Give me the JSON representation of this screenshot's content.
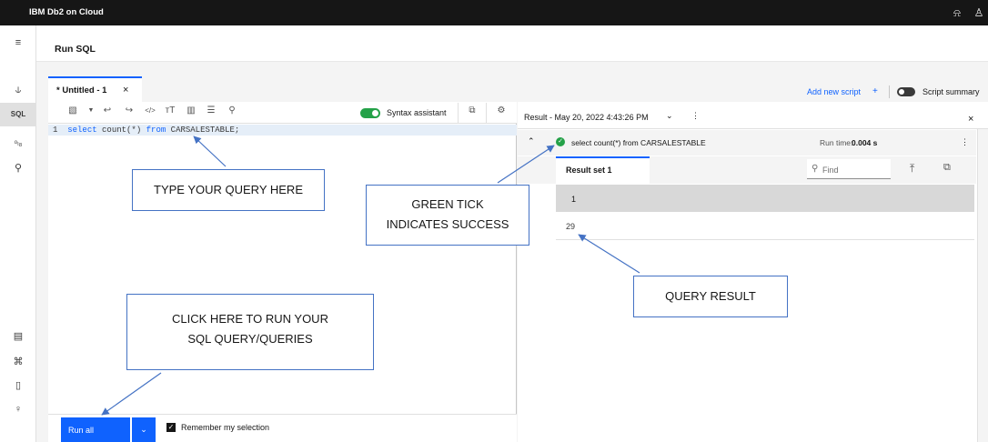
{
  "app": {
    "title": "IBM Db2 on Cloud"
  },
  "page": {
    "title": "Run SQL"
  },
  "rail": {
    "items": [
      {
        "icon": "menu-icon",
        "glyph": "≡"
      },
      {
        "icon": "chart-icon",
        "glyph": "⩘"
      },
      {
        "icon": "sql-icon",
        "glyph": "SQL"
      },
      {
        "icon": "data-icon",
        "glyph": "ⁱ⁰"
      },
      {
        "icon": "tool-icon",
        "glyph": "✎"
      },
      {
        "icon": "console-icon",
        "glyph": "▤"
      },
      {
        "icon": "network-icon",
        "glyph": "⌘"
      },
      {
        "icon": "document-icon",
        "glyph": "🗎"
      },
      {
        "icon": "bulb-icon",
        "glyph": "♡"
      }
    ]
  },
  "editor": {
    "tab_label": "* Untitled - 1",
    "tab_close": "×",
    "syntax_assistant": "Syntax assistant",
    "line_number": "1",
    "sql_keyword1": "select",
    "sql_middle": "count(*)",
    "sql_keyword2": "from",
    "sql_table": "CARSALESTABLE;"
  },
  "toolbar_icons": [
    "save-icon",
    "dropdown-icon",
    "undo-icon",
    "redo-icon",
    "code-icon",
    "text-size-icon",
    "delete-icon",
    "format-icon",
    "search-icon",
    "open-icon",
    "settings-icon"
  ],
  "header_actions": {
    "add_script": "Add new script",
    "add_plus": "+",
    "script_summary": "Script summary"
  },
  "result": {
    "title": "Result - May 20, 2022 4:43:26 PM",
    "query": "select count(*) from CARSALESTABLE",
    "runtime_label": "Run time:",
    "runtime_value": "0.004 s",
    "tab": "Result set 1",
    "find_placeholder": "Find",
    "column_header": "1",
    "value": "29",
    "close": "×"
  },
  "run": {
    "button": "Run all",
    "remember": "Remember my selection"
  },
  "annotations": {
    "type_query": "TYPE YOUR QUERY HERE",
    "green_tick_1": "GREEN TICK",
    "green_tick_2": "INDICATES SUCCESS",
    "query_result": "QUERY RESULT",
    "click_run_1": "CLICK HERE TO RUN YOUR",
    "click_run_2": "SQL QUERY/QUERIES"
  },
  "colors": {
    "accent": "#0f62fe",
    "success": "#24a148",
    "annotation_border": "#4472c4",
    "header": "#161616"
  }
}
